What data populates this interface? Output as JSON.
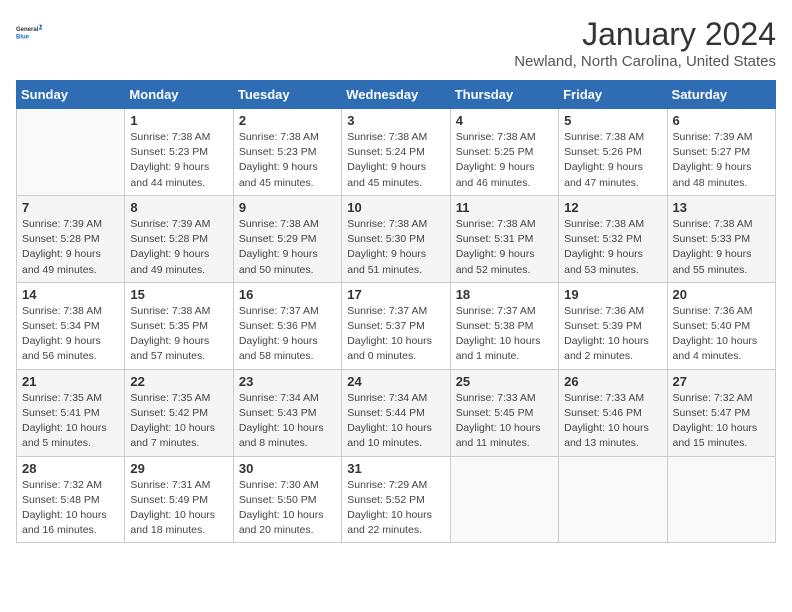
{
  "logo": {
    "line1": "General",
    "line2": "Blue"
  },
  "title": "January 2024",
  "subtitle": "Newland, North Carolina, United States",
  "days_of_week": [
    "Sunday",
    "Monday",
    "Tuesday",
    "Wednesday",
    "Thursday",
    "Friday",
    "Saturday"
  ],
  "weeks": [
    [
      {
        "day": "",
        "sunrise": "",
        "sunset": "",
        "daylight": ""
      },
      {
        "day": "1",
        "sunrise": "Sunrise: 7:38 AM",
        "sunset": "Sunset: 5:23 PM",
        "daylight": "Daylight: 9 hours and 44 minutes."
      },
      {
        "day": "2",
        "sunrise": "Sunrise: 7:38 AM",
        "sunset": "Sunset: 5:23 PM",
        "daylight": "Daylight: 9 hours and 45 minutes."
      },
      {
        "day": "3",
        "sunrise": "Sunrise: 7:38 AM",
        "sunset": "Sunset: 5:24 PM",
        "daylight": "Daylight: 9 hours and 45 minutes."
      },
      {
        "day": "4",
        "sunrise": "Sunrise: 7:38 AM",
        "sunset": "Sunset: 5:25 PM",
        "daylight": "Daylight: 9 hours and 46 minutes."
      },
      {
        "day": "5",
        "sunrise": "Sunrise: 7:38 AM",
        "sunset": "Sunset: 5:26 PM",
        "daylight": "Daylight: 9 hours and 47 minutes."
      },
      {
        "day": "6",
        "sunrise": "Sunrise: 7:39 AM",
        "sunset": "Sunset: 5:27 PM",
        "daylight": "Daylight: 9 hours and 48 minutes."
      }
    ],
    [
      {
        "day": "7",
        "sunrise": "Sunrise: 7:39 AM",
        "sunset": "Sunset: 5:28 PM",
        "daylight": "Daylight: 9 hours and 49 minutes."
      },
      {
        "day": "8",
        "sunrise": "Sunrise: 7:39 AM",
        "sunset": "Sunset: 5:28 PM",
        "daylight": "Daylight: 9 hours and 49 minutes."
      },
      {
        "day": "9",
        "sunrise": "Sunrise: 7:38 AM",
        "sunset": "Sunset: 5:29 PM",
        "daylight": "Daylight: 9 hours and 50 minutes."
      },
      {
        "day": "10",
        "sunrise": "Sunrise: 7:38 AM",
        "sunset": "Sunset: 5:30 PM",
        "daylight": "Daylight: 9 hours and 51 minutes."
      },
      {
        "day": "11",
        "sunrise": "Sunrise: 7:38 AM",
        "sunset": "Sunset: 5:31 PM",
        "daylight": "Daylight: 9 hours and 52 minutes."
      },
      {
        "day": "12",
        "sunrise": "Sunrise: 7:38 AM",
        "sunset": "Sunset: 5:32 PM",
        "daylight": "Daylight: 9 hours and 53 minutes."
      },
      {
        "day": "13",
        "sunrise": "Sunrise: 7:38 AM",
        "sunset": "Sunset: 5:33 PM",
        "daylight": "Daylight: 9 hours and 55 minutes."
      }
    ],
    [
      {
        "day": "14",
        "sunrise": "Sunrise: 7:38 AM",
        "sunset": "Sunset: 5:34 PM",
        "daylight": "Daylight: 9 hours and 56 minutes."
      },
      {
        "day": "15",
        "sunrise": "Sunrise: 7:38 AM",
        "sunset": "Sunset: 5:35 PM",
        "daylight": "Daylight: 9 hours and 57 minutes."
      },
      {
        "day": "16",
        "sunrise": "Sunrise: 7:37 AM",
        "sunset": "Sunset: 5:36 PM",
        "daylight": "Daylight: 9 hours and 58 minutes."
      },
      {
        "day": "17",
        "sunrise": "Sunrise: 7:37 AM",
        "sunset": "Sunset: 5:37 PM",
        "daylight": "Daylight: 10 hours and 0 minutes."
      },
      {
        "day": "18",
        "sunrise": "Sunrise: 7:37 AM",
        "sunset": "Sunset: 5:38 PM",
        "daylight": "Daylight: 10 hours and 1 minute."
      },
      {
        "day": "19",
        "sunrise": "Sunrise: 7:36 AM",
        "sunset": "Sunset: 5:39 PM",
        "daylight": "Daylight: 10 hours and 2 minutes."
      },
      {
        "day": "20",
        "sunrise": "Sunrise: 7:36 AM",
        "sunset": "Sunset: 5:40 PM",
        "daylight": "Daylight: 10 hours and 4 minutes."
      }
    ],
    [
      {
        "day": "21",
        "sunrise": "Sunrise: 7:35 AM",
        "sunset": "Sunset: 5:41 PM",
        "daylight": "Daylight: 10 hours and 5 minutes."
      },
      {
        "day": "22",
        "sunrise": "Sunrise: 7:35 AM",
        "sunset": "Sunset: 5:42 PM",
        "daylight": "Daylight: 10 hours and 7 minutes."
      },
      {
        "day": "23",
        "sunrise": "Sunrise: 7:34 AM",
        "sunset": "Sunset: 5:43 PM",
        "daylight": "Daylight: 10 hours and 8 minutes."
      },
      {
        "day": "24",
        "sunrise": "Sunrise: 7:34 AM",
        "sunset": "Sunset: 5:44 PM",
        "daylight": "Daylight: 10 hours and 10 minutes."
      },
      {
        "day": "25",
        "sunrise": "Sunrise: 7:33 AM",
        "sunset": "Sunset: 5:45 PM",
        "daylight": "Daylight: 10 hours and 11 minutes."
      },
      {
        "day": "26",
        "sunrise": "Sunrise: 7:33 AM",
        "sunset": "Sunset: 5:46 PM",
        "daylight": "Daylight: 10 hours and 13 minutes."
      },
      {
        "day": "27",
        "sunrise": "Sunrise: 7:32 AM",
        "sunset": "Sunset: 5:47 PM",
        "daylight": "Daylight: 10 hours and 15 minutes."
      }
    ],
    [
      {
        "day": "28",
        "sunrise": "Sunrise: 7:32 AM",
        "sunset": "Sunset: 5:48 PM",
        "daylight": "Daylight: 10 hours and 16 minutes."
      },
      {
        "day": "29",
        "sunrise": "Sunrise: 7:31 AM",
        "sunset": "Sunset: 5:49 PM",
        "daylight": "Daylight: 10 hours and 18 minutes."
      },
      {
        "day": "30",
        "sunrise": "Sunrise: 7:30 AM",
        "sunset": "Sunset: 5:50 PM",
        "daylight": "Daylight: 10 hours and 20 minutes."
      },
      {
        "day": "31",
        "sunrise": "Sunrise: 7:29 AM",
        "sunset": "Sunset: 5:52 PM",
        "daylight": "Daylight: 10 hours and 22 minutes."
      },
      {
        "day": "",
        "sunrise": "",
        "sunset": "",
        "daylight": ""
      },
      {
        "day": "",
        "sunrise": "",
        "sunset": "",
        "daylight": ""
      },
      {
        "day": "",
        "sunrise": "",
        "sunset": "",
        "daylight": ""
      }
    ]
  ]
}
